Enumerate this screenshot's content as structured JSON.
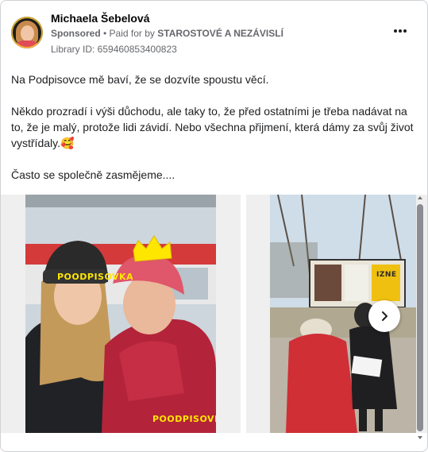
{
  "post": {
    "author": "Michaela Šebelová",
    "sponsored_label": "Sponsored",
    "separator": " • ",
    "paid_for_prefix": "Paid for by ",
    "payer": "STAROSTOVÉ A NEZÁVISLÍ",
    "library_id": "Library ID: 659460853400823",
    "paragraphs": [
      "Na Podpisovce mě baví, že se dozvíte spoustu věcí.",
      "Někdo prozradí i výši důchodu, ale taky to, že před ostatními je třeba nadávat na to, že je malý, protože lidi závidí. Nebo všechna přijmení, která dámy za svůj život vystřídaly.🥰",
      "Často se společně zasmějeme...."
    ]
  },
  "carousel": {
    "slide1": {
      "hat_text": "POODPISOVKA",
      "watermark": "POODPISOVKA"
    },
    "slide2": {
      "sign_text": "IZNE"
    }
  },
  "icons": {
    "more": "more-dots-icon",
    "next": "chevron-right-icon"
  },
  "colors": {
    "brand_yellow": "#ffe600",
    "meta_gray": "#65676b",
    "text": "#1c1e21"
  }
}
